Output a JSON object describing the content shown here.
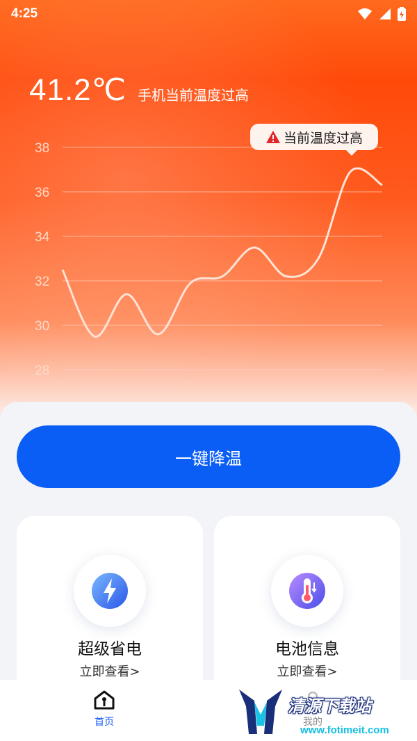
{
  "status_bar": {
    "time": "4:25"
  },
  "header": {
    "temperature": "41.2℃",
    "message": "手机当前温度过高",
    "tooltip": "当前温度过高"
  },
  "chart_data": {
    "type": "line",
    "y_ticks": [
      "38",
      "36",
      "34",
      "32",
      "30",
      "28"
    ],
    "ylim": [
      28,
      38
    ],
    "x": [
      0,
      1,
      2,
      3,
      4,
      5,
      6,
      7,
      8,
      9,
      10,
      11
    ],
    "values": [
      32.5,
      29.5,
      31.4,
      29.6,
      31.9,
      32.2,
      33.5,
      32.2,
      33.0,
      36.9,
      36.3
    ],
    "grid": true,
    "colors": {
      "line": "#ffe3d6",
      "grid": "#ffd1bd"
    }
  },
  "actions": {
    "cool_button": "一键降温"
  },
  "cards": [
    {
      "title": "超级省电",
      "link": "立即查看>",
      "icon": "lightning-icon"
    },
    {
      "title": "电池信息",
      "link": "立即查看>",
      "icon": "thermometer-icon"
    }
  ],
  "bottom_nav": [
    {
      "label": "首页",
      "icon": "home-icon",
      "active": true
    },
    {
      "label": "我的",
      "icon": "user-icon",
      "active": false
    }
  ],
  "watermark": {
    "title": "清源下载站",
    "url": "www.fotimeit.com"
  },
  "colors": {
    "accent": "#0a5ef5",
    "hero": "#ff4a0a"
  }
}
